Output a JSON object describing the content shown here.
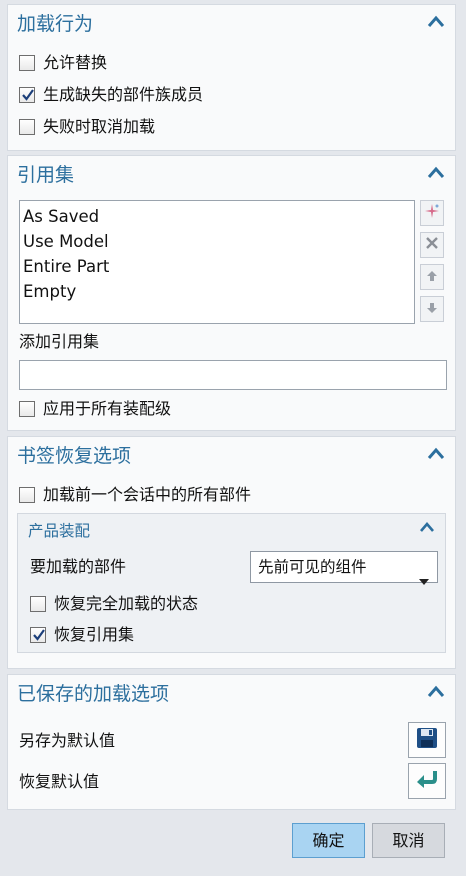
{
  "loading_behavior": {
    "title": "加载行为",
    "options": [
      {
        "label": "允许替换",
        "checked": false
      },
      {
        "label": "生成缺失的部件族成员",
        "checked": true
      },
      {
        "label": "失败时取消加载",
        "checked": false
      }
    ]
  },
  "reference_sets": {
    "title": "引用集",
    "list": [
      "As Saved",
      "Use Model",
      "Entire Part",
      "Empty"
    ],
    "add_label": "添加引用集",
    "add_value": "",
    "apply_all": {
      "label": "应用于所有装配级",
      "checked": false
    }
  },
  "bookmark": {
    "title": "书签恢复选项",
    "load_all": {
      "label": "加载前一个会话中的所有部件",
      "checked": false
    },
    "product_assembly": {
      "title": "产品装配",
      "components_label": "要加载的部件",
      "components_value": "先前可见的组件",
      "restore_state": {
        "label": "恢复完全加载的状态",
        "checked": false
      },
      "restore_refset": {
        "label": "恢复引用集",
        "checked": true
      }
    }
  },
  "saved_options": {
    "title": "已保存的加载选项",
    "save_default_label": "另存为默认值",
    "restore_default_label": "恢复默认值"
  },
  "dialog": {
    "ok": "确定",
    "cancel": "取消"
  },
  "colors": {
    "section_title": "#2c6f9e",
    "ok_button": "#a9d4f2",
    "background": "#e4e7ec"
  }
}
